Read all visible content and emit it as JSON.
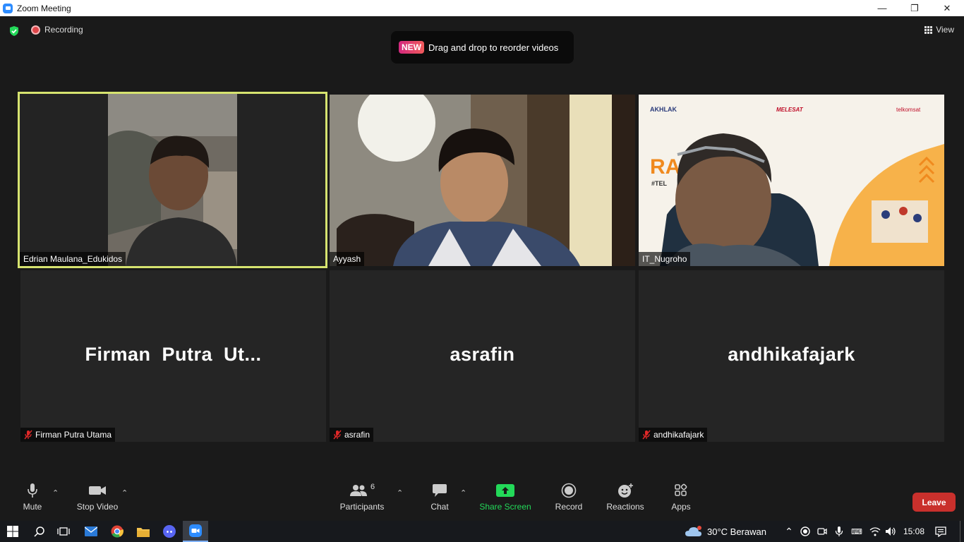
{
  "window": {
    "title": "Zoom Meeting",
    "minimize": "—",
    "restore": "❐",
    "close": "✕"
  },
  "meeting": {
    "recording_label": "Recording",
    "view_label": "View",
    "banner": {
      "badge": "NEW",
      "text": "Drag and drop to reorder videos"
    }
  },
  "participants_tiles": [
    {
      "name": "Edrian Maulana_Edukidos",
      "video": true,
      "active_speaker": true
    },
    {
      "name": "Ayyash",
      "video": true
    },
    {
      "name": "IT_Nugroho",
      "video": true,
      "overlay": {
        "brand1": "AKHLAK",
        "brand2": "MELESAT",
        "brand3": "telkomsat",
        "partial1": "RA",
        "partial2": "#TEL"
      }
    },
    {
      "name": "Firman Putra Utama",
      "display_name": "Firman  Putra  Ut...",
      "video": false,
      "muted": true
    },
    {
      "name": "asrafin",
      "display_name": "asrafin",
      "video": false,
      "muted": true
    },
    {
      "name": "andhikafajark",
      "display_name": "andhikafajark",
      "video": false,
      "muted": true
    }
  ],
  "toolbar": {
    "mute": "Mute",
    "stop_video": "Stop Video",
    "participants": "Participants",
    "participants_count": "6",
    "chat": "Chat",
    "share_screen": "Share Screen",
    "record": "Record",
    "reactions": "Reactions",
    "apps": "Apps",
    "leave": "Leave"
  },
  "taskbar": {
    "weather": "30°C  Berawan",
    "time": "15:08"
  },
  "colors": {
    "active_speaker_border": "#d6e36f",
    "share_green": "#23d959",
    "leave_red": "#c9302c",
    "zoom_blue": "#2d8cff"
  }
}
